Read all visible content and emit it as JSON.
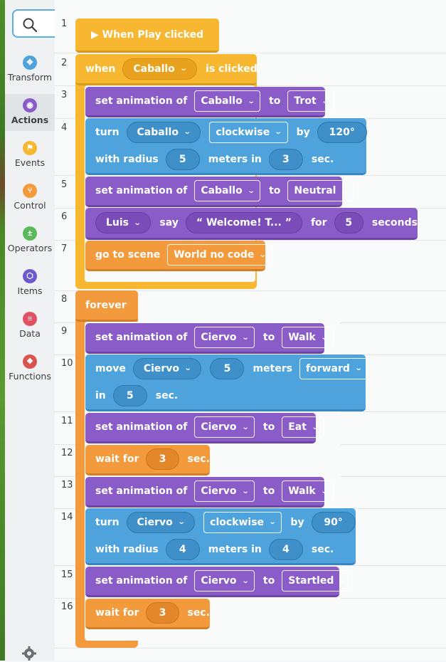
{
  "sidebar": {
    "items": [
      {
        "label": "Transform",
        "icon": "move-arrows-icon",
        "color": "#4ea3dc",
        "glyph": "✥",
        "active": false
      },
      {
        "label": "Actions",
        "icon": "eye-icon",
        "color": "#8a5cc7",
        "glyph": "◉",
        "active": true
      },
      {
        "label": "Events",
        "icon": "flag-icon",
        "color": "#f7b731",
        "glyph": "⚑",
        "active": false
      },
      {
        "label": "Control",
        "icon": "branch-icon",
        "color": "#f39a3d",
        "glyph": "⑂",
        "active": false
      },
      {
        "label": "Operators",
        "icon": "plus-minus-icon",
        "color": "#5cb85c",
        "glyph": "±",
        "active": false
      },
      {
        "label": "Items",
        "icon": "cube-icon",
        "color": "#6a5acd",
        "glyph": "⬡",
        "active": false
      },
      {
        "label": "Data",
        "icon": "database-icon",
        "color": "#e05263",
        "glyph": "≡",
        "active": false
      },
      {
        "label": "Functions",
        "icon": "function-icon",
        "color": "#d9534f",
        "glyph": "❖",
        "active": false
      }
    ]
  },
  "lines": [
    "1",
    "2",
    "3",
    "4",
    "5",
    "6",
    "7",
    "8",
    "9",
    "10",
    "11",
    "12",
    "13",
    "14",
    "15",
    "16"
  ],
  "code": {
    "b1": {
      "label": "▶ When Play clicked"
    },
    "b2": {
      "when": "when",
      "target": "Caballo",
      "suffix": "is clicked"
    },
    "b3": {
      "text": "set animation of",
      "obj": "Caballo",
      "to": "to",
      "anim": "Trot"
    },
    "b4": {
      "turn": "turn",
      "obj": "Caballo",
      "dir": "clockwise",
      "by": "by",
      "deg": "120°",
      "radius_label": "with radius",
      "radius": "5",
      "meters_in": "meters in",
      "time": "3",
      "sec": "sec."
    },
    "b5": {
      "text": "set animation of",
      "obj": "Caballo",
      "to": "to",
      "anim": "Neutral"
    },
    "b6": {
      "who": "Luis",
      "say": "say",
      "msg": "“ Welcome! T... ”",
      "for": "for",
      "n": "5",
      "seconds": "seconds"
    },
    "b7": {
      "text": "go to scene",
      "scene": "World no code"
    },
    "b8": {
      "text": "forever"
    },
    "b9": {
      "text": "set animation of",
      "obj": "Ciervo",
      "to": "to",
      "anim": "Walk"
    },
    "b10": {
      "move": "move",
      "obj": "Ciervo",
      "n": "5",
      "meters": "meters",
      "dir": "forward",
      "in": "in",
      "time": "5",
      "sec": "sec."
    },
    "b11": {
      "text": "set animation of",
      "obj": "Ciervo",
      "to": "to",
      "anim": "Eat"
    },
    "b12": {
      "text": "wait for",
      "n": "3",
      "sec": "sec."
    },
    "b13": {
      "text": "set animation of",
      "obj": "Ciervo",
      "to": "to",
      "anim": "Walk"
    },
    "b14": {
      "turn": "turn",
      "obj": "Ciervo",
      "dir": "clockwise",
      "by": "by",
      "deg": "90°",
      "radius_label": "with radius",
      "radius": "4",
      "meters_in": "meters in",
      "time": "4",
      "sec": "sec."
    },
    "b15": {
      "text": "set animation of",
      "obj": "Ciervo",
      "to": "to",
      "anim": "Startled"
    },
    "b16": {
      "text": "wait for",
      "n": "3",
      "sec": "sec."
    }
  },
  "colors": {
    "purple": "#8a5cc7",
    "blue": "#4ea3dc",
    "yellow": "#f7b731",
    "orange": "#f39a3d",
    "search_border": "#5aaee6"
  }
}
